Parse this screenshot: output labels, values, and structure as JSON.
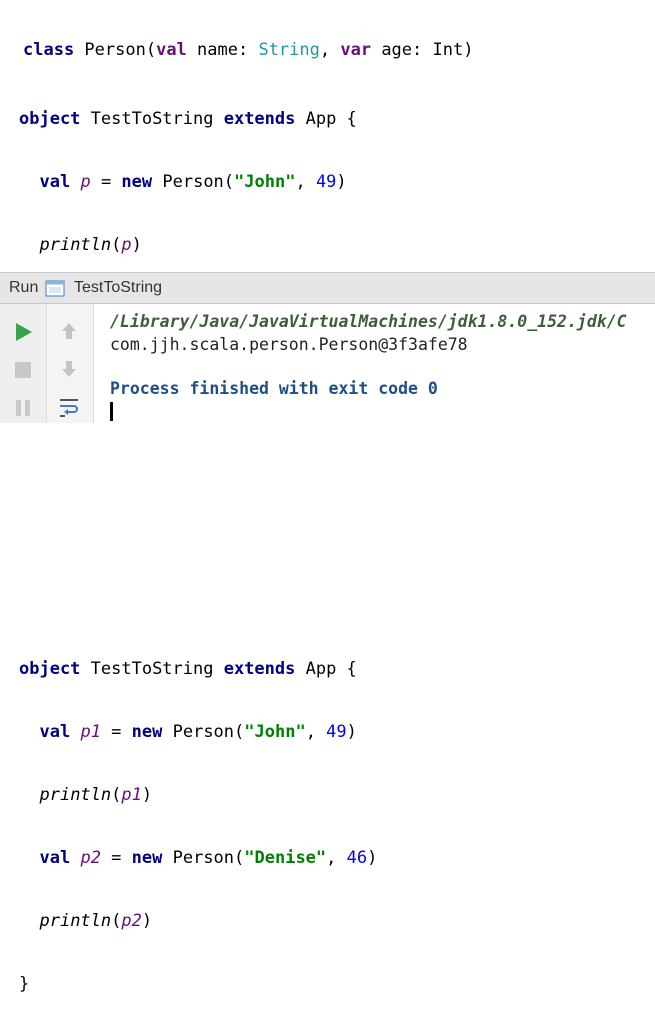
{
  "code_top": {
    "class_keyword": "class",
    "class_name": " Person(",
    "val_keyword": "val",
    "name_param": " name: ",
    "string_type": "String",
    "comma": ", ",
    "var_keyword": "var",
    "age_param": " age: Int)"
  },
  "code_block_1": {
    "line1": {
      "object_kw": "object",
      "name": " TestToString ",
      "extends_kw": "extends",
      "rest": " App {"
    },
    "line2": {
      "indent": "  ",
      "val_kw": "val",
      "sp": " ",
      "var": "p",
      "eq": " = ",
      "new_kw": "new",
      "ctor": " Person(",
      "str": "\"John\"",
      "comma": ", ",
      "num": "49",
      "close": ")"
    },
    "line3": {
      "indent": "  ",
      "fn": "println",
      "open": "(",
      "arg": "p",
      "close": ")"
    },
    "line4": {
      "brace": "}"
    }
  },
  "run_panel": {
    "run_label": "Run",
    "tab_label": "TestToString",
    "console": {
      "path_line": "/Library/Java/JavaVirtualMachines/jdk1.8.0_152.jdk/C",
      "output_line": "com.jjh.scala.person.Person@3f3afe78",
      "finish_line": "Process finished with exit code 0"
    },
    "icons": {
      "run": "play-icon",
      "stop": "stop-icon",
      "pause": "pause-icon",
      "up": "arrow-up-icon",
      "down": "arrow-down-icon",
      "wrap": "soft-wrap-icon",
      "tab": "console-tab-icon"
    },
    "colors": {
      "run_green": "#3aa34a",
      "header_bg": "#e6e6e6"
    }
  },
  "code_block_2": {
    "line1": {
      "object_kw": "object",
      "name": " TestToString ",
      "extends_kw": "extends",
      "rest": " App {"
    },
    "line2": {
      "indent": "  ",
      "val_kw": "val",
      "sp": " ",
      "var": "p1",
      "eq": " = ",
      "new_kw": "new",
      "ctor": " Person(",
      "str": "\"John\"",
      "comma": ", ",
      "num": "49",
      "close": ")"
    },
    "line3": {
      "indent": "  ",
      "fn": "println",
      "open": "(",
      "arg": "p1",
      "close": ")"
    },
    "line4": {
      "indent": "  ",
      "val_kw": "val",
      "sp": " ",
      "var": "p2",
      "eq": " = ",
      "new_kw": "new",
      "ctor": " Person(",
      "str": "\"Denise\"",
      "comma": ", ",
      "num": "46",
      "close": ")"
    },
    "line5": {
      "indent": "  ",
      "fn": "println",
      "open": "(",
      "arg": "p2",
      "close": ")"
    },
    "line6": {
      "brace": "}"
    }
  }
}
